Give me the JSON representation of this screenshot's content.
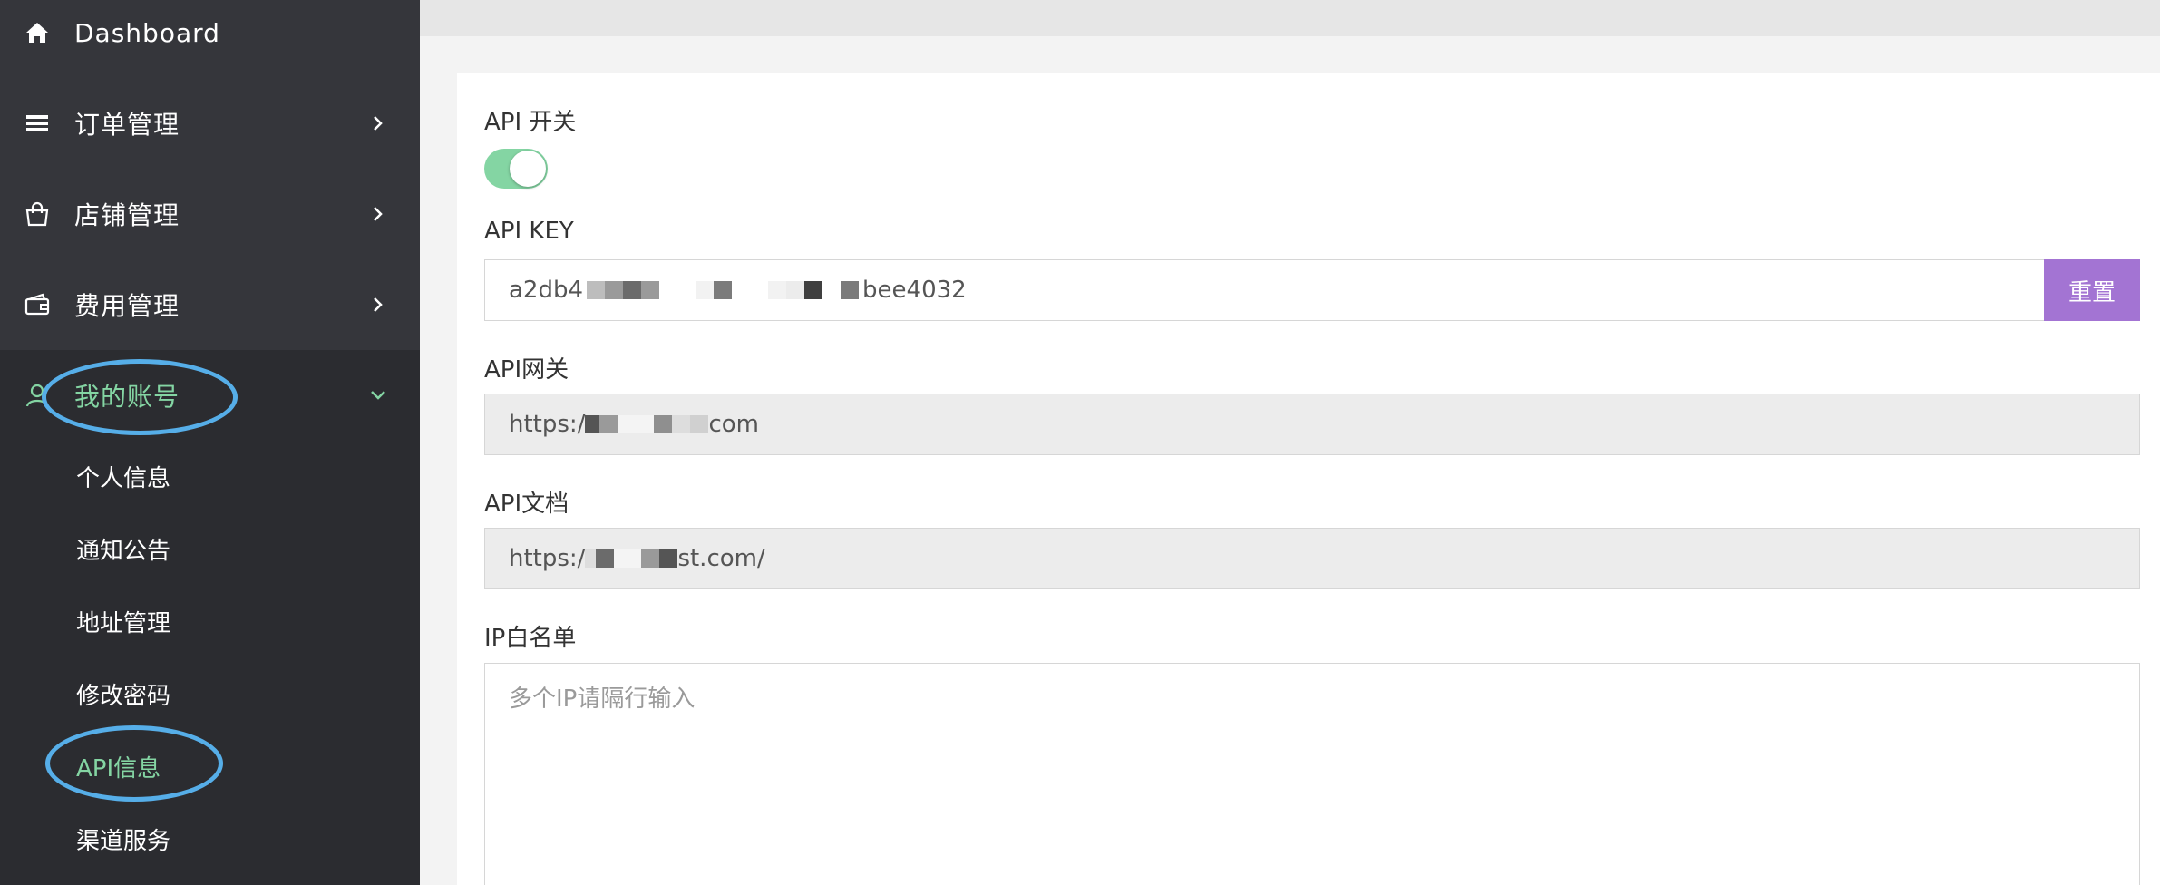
{
  "sidebar": {
    "items": [
      {
        "label": "Dashboard",
        "icon": "home-icon"
      },
      {
        "label": "订单管理",
        "icon": "list-icon"
      },
      {
        "label": "店铺管理",
        "icon": "shopping-bag-icon"
      },
      {
        "label": "费用管理",
        "icon": "wallet-icon"
      },
      {
        "label": "我的账号",
        "icon": "user-icon"
      }
    ],
    "sub_items": [
      {
        "label": "个人信息"
      },
      {
        "label": "通知公告"
      },
      {
        "label": "地址管理"
      },
      {
        "label": "修改密码"
      },
      {
        "label": "API信息"
      },
      {
        "label": "渠道服务"
      }
    ],
    "active_item": "我的账号",
    "active_sub_item": "API信息"
  },
  "form": {
    "api_switch_label": "API 开关",
    "api_switch_on": true,
    "api_key_label": "API KEY",
    "api_key_prefix": "a2db4",
    "api_key_suffix": "bee4032",
    "reset_label": "重置",
    "gateway_label": "API网关",
    "gateway_prefix": "https:/",
    "gateway_suffix": "com",
    "docs_label": "API文档",
    "docs_prefix": "https:/",
    "docs_suffix": "st.com/",
    "whitelist_label": "IP白名单",
    "whitelist_placeholder": "多个IP请隔行输入"
  },
  "colors": {
    "sidebar_bg": "#2b2c30",
    "active_green": "#84d5a3",
    "reset_purple": "#a374d3",
    "annotation_blue": "#56aee8"
  }
}
